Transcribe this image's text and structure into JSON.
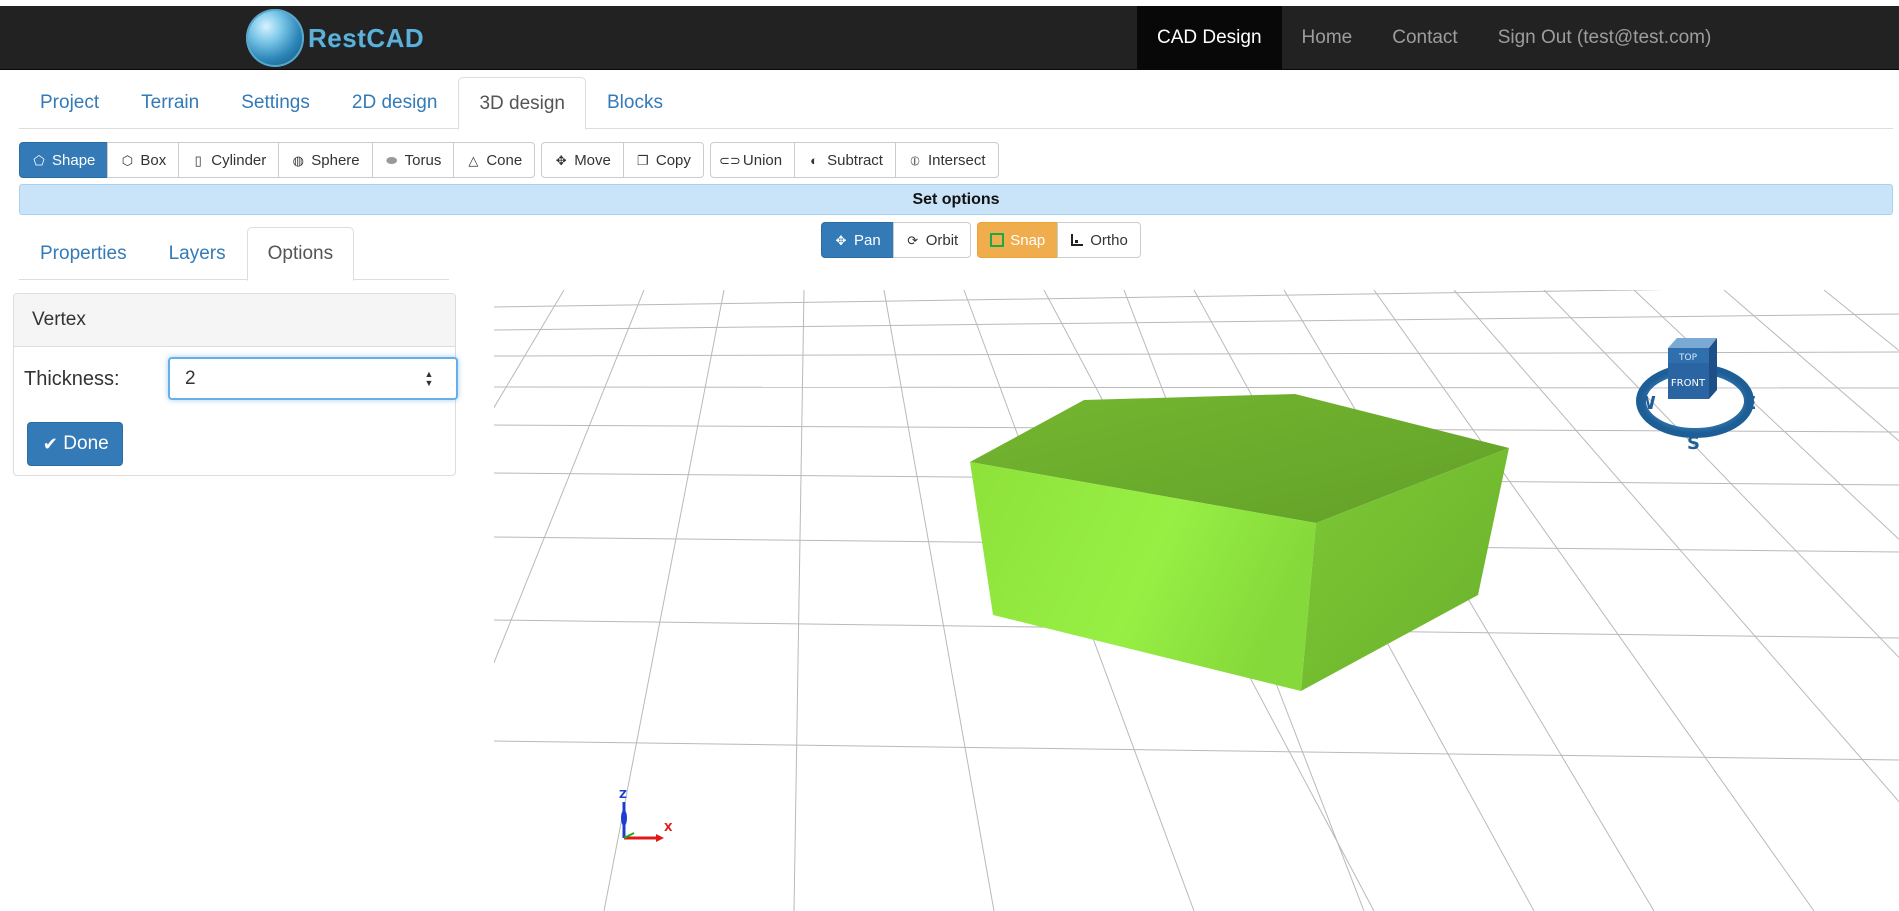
{
  "navbar": {
    "brand": "RestCAD",
    "links": [
      {
        "label": "CAD Design",
        "active": true
      },
      {
        "label": "Home",
        "active": false
      },
      {
        "label": "Contact",
        "active": false
      },
      {
        "label": "Sign Out (test@test.com)",
        "active": false
      }
    ]
  },
  "main_tabs": [
    {
      "label": "Project",
      "active": false
    },
    {
      "label": "Terrain",
      "active": false
    },
    {
      "label": "Settings",
      "active": false
    },
    {
      "label": "2D design",
      "active": false
    },
    {
      "label": "3D design",
      "active": true
    },
    {
      "label": "Blocks",
      "active": false
    }
  ],
  "toolbar": {
    "shape": "Shape",
    "box": "Box",
    "cylinder": "Cylinder",
    "sphere": "Sphere",
    "torus": "Torus",
    "cone": "Cone",
    "move": "Move",
    "copy": "Copy",
    "union": "Union",
    "subtract": "Subtract",
    "intersect": "Intersect"
  },
  "banner": "Set options",
  "viewbar": {
    "pan": "Pan",
    "orbit": "Orbit",
    "snap": "Snap",
    "ortho": "Ortho"
  },
  "side_tabs": [
    {
      "label": "Properties",
      "active": false
    },
    {
      "label": "Layers",
      "active": false
    },
    {
      "label": "Options",
      "active": true
    }
  ],
  "panel": {
    "title": "Vertex",
    "thickness_label": "Thickness:",
    "thickness_value": "2",
    "done_label": "Done"
  },
  "viewport": {
    "compass": {
      "top": "TOP",
      "front": "FRONT",
      "w": "W",
      "e": "E",
      "s": "S"
    },
    "axes": {
      "z": "Z",
      "x": "X"
    },
    "shape_color": "#8bd83a"
  }
}
